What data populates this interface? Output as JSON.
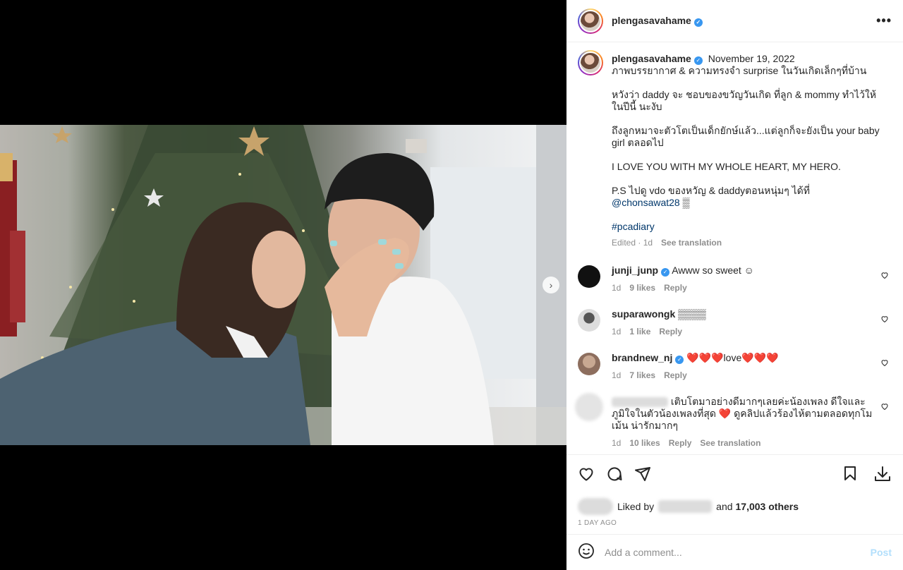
{
  "post": {
    "username": "plengasavahame",
    "date": "November 19, 2022",
    "carousel": {
      "slides": 7,
      "active_index": 0
    }
  },
  "caption": {
    "line1": "ภาพบรรยากาศ & ความทรงจำ surprise ในวันเกิดเล็กๆที่บ้าน",
    "para2": "หวังว่า daddy จะ ชอบของขวัญวันเกิด ที่ลูก & mommy ทำไว้ให้ในปีนี้ นะงับ",
    "para3": "ถึงลูกหมาจะตัวโตเป็นเด็กยักษ์แล้ว...แต่ลูกก็จะยังเป็น your baby girl ตลอดไป",
    "para4": "I LOVE YOU WITH MY WHOLE HEART, MY HERO.",
    "para5_text": "P.S ไปดู vdo ของหวัญ & daddyตอนหนุ่มๆ ได้ที่ ",
    "para5_mention": "@chonsawat28",
    "para5_tail": " ▒",
    "hashtag": "#pcadiary",
    "edited": "Edited · 1d",
    "see_translation": "See translation"
  },
  "comments": [
    {
      "user": "junji_junp",
      "text": "Awww so sweet ☺",
      "time": "1d",
      "likes": "9 likes",
      "reply": "Reply",
      "avatar_color": "#1a1a1a"
    },
    {
      "user": "suparawongk",
      "text": "▒▒▒▒",
      "time": "1d",
      "likes": "1 like",
      "reply": "Reply",
      "avatar_color": "#cfcfcf"
    },
    {
      "user": "brandnew_nj",
      "text_a": "❤️❤️❤️",
      "text_b": "love",
      "text_c": "❤️❤️❤️",
      "time": "1d",
      "likes": "7 likes",
      "reply": "Reply",
      "avatar_color": "#b79e8c"
    },
    {
      "text_a": "เติบโตมาอย่างดีมากๆเลยค่ะน้องเพลง ดีใจและภูมิใจในตัวน้องเพลงที่สุด ",
      "heart": "❤️",
      "text_b": " ดูคลิปแล้วร้องไห้ตามตลอดทุกโมเม้น น่ารักมากๆ",
      "time": "1d",
      "likes": "10 likes",
      "reply": "Reply",
      "see_translation": "See translation"
    }
  ],
  "likes": {
    "prefix": "Liked by",
    "and_text": "and",
    "count": "17,003 others"
  },
  "time_ago": "1 DAY AGO",
  "add_comment": {
    "placeholder": "Add a comment...",
    "post_label": "Post"
  },
  "colors": {
    "link": "#00376b",
    "verified": "#3897f0",
    "post_disabled": "#b2dffc",
    "muted": "#8e8e8e"
  },
  "icons": [
    "heart-icon",
    "comment-icon",
    "share-icon",
    "bookmark-icon",
    "download-icon",
    "emoji-icon",
    "more-icon",
    "verified-icon",
    "next-arrow-icon",
    "user-tag-icon"
  ]
}
